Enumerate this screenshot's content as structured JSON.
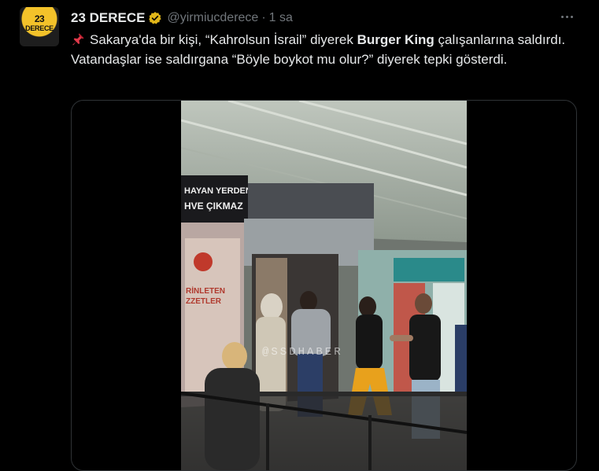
{
  "tweet": {
    "avatar": {
      "number": "23",
      "brand": "DERECE"
    },
    "display_name": "23 DERECE",
    "verified_icon": "verified-badge-icon",
    "handle": "@yirmiucderece",
    "separator": "·",
    "time": "1 sa",
    "more_icon": "more-options-icon",
    "text_parts": {
      "pin_icon": "pushpin-icon",
      "before_brand": "Sakarya'da bir kişi, “Kahrolsun İsrail” diyerek ",
      "brand": "Burger King",
      "after_brand": " çalışanlarına saldırdı. Vatandaşlar ise saldırgana “Böyle boykot mu olur?” diyerek tepki gösterdi."
    }
  },
  "media": {
    "sign_line1": "HAYAN YERDEN",
    "sign_line2": "HVE ÇIKMAZ",
    "window_text_line1": "RİNLETEN",
    "window_text_line2": "ZZETLER",
    "watermark": "@SSDHABER"
  },
  "colors": {
    "background": "#000000",
    "text": "#e7e9ea",
    "muted": "#71767b",
    "verified": "#e2b719",
    "avatar_yellow": "#f3c22a",
    "border": "#2f3336"
  }
}
